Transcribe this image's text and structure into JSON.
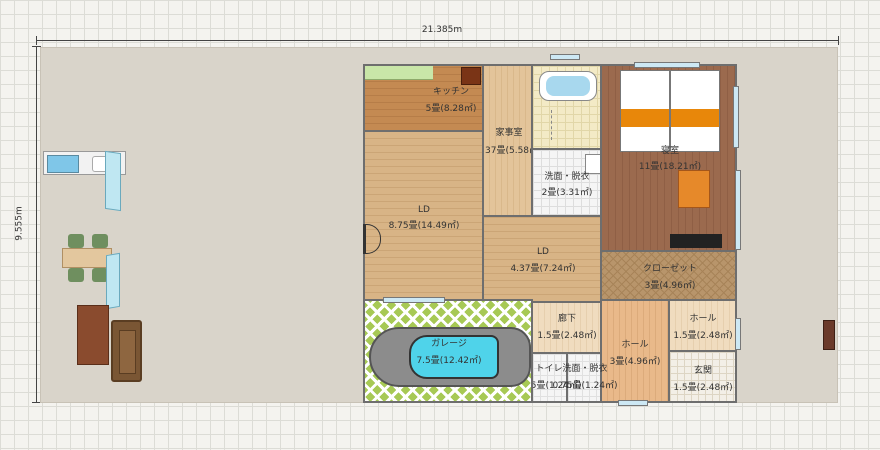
{
  "dimensions": {
    "width": "21.385m",
    "height": "9.555m"
  },
  "rooms": {
    "kitchen": {
      "name": "キッチン",
      "area": "5畳(8.28㎡)"
    },
    "study": {
      "name": "家事室",
      "area": "3.37畳(5.58㎡)"
    },
    "wash_top": {
      "name": "洗面・脱衣",
      "area": "2畳(3.31㎡)"
    },
    "bedroom": {
      "name": "寝室",
      "area": "11畳(18.21㎡)"
    },
    "ld_left": {
      "name": "LD",
      "area": "8.75畳(14.49㎡)"
    },
    "ld_mid": {
      "name": "LD",
      "area": "4.37畳(7.24㎡)"
    },
    "closet": {
      "name": "クローゼット",
      "area": "3畳(4.96㎡)"
    },
    "hall_tr": {
      "name": "ホール",
      "area": "1.5畳(2.48㎡)"
    },
    "corridor": {
      "name": "廊下",
      "area": "1.5畳(2.48㎡)"
    },
    "garage": {
      "name": "ガレージ",
      "area": "7.5畳(12.42㎡)"
    },
    "hall_mid": {
      "name": "ホール",
      "area": "3畳(4.96㎡)"
    },
    "entrance": {
      "name": "玄関",
      "area": "1.5畳(2.48㎡)"
    },
    "toilet": {
      "name": "トイレ",
      "area": "0.75畳(1.24㎡)"
    },
    "wash_bottom": {
      "name": "洗面・脱衣",
      "area": "0.75畳(1.24㎡)"
    }
  }
}
